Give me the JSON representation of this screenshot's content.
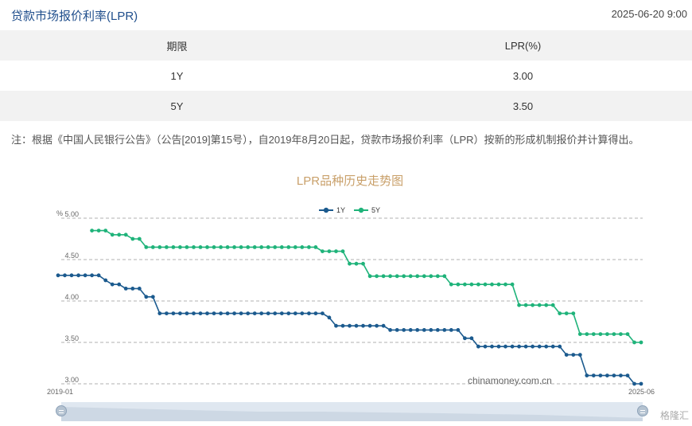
{
  "header": {
    "title": "贷款市场报价利率(LPR)",
    "timestamp": "2025-06-20 9:00"
  },
  "table": {
    "headers": [
      "期限",
      "LPR(%)"
    ],
    "rows": [
      {
        "term": "1Y",
        "rate": "3.00"
      },
      {
        "term": "5Y",
        "rate": "3.50"
      }
    ]
  },
  "note": "注：根据《中国人民银行公告》（公告[2019]第15号），自2019年8月20日起，贷款市场报价利率（LPR）按新的形成机制报价并计算得出。",
  "watermark": "chinamoney.com.cn",
  "logo_text": "格隆汇",
  "colors": {
    "series_1y": "#1b5a8e",
    "series_5y": "#1fb37a",
    "title": "#c9a06a",
    "grid": "#999999"
  },
  "chart_data": {
    "type": "line",
    "title": "LPR品种历史走势图",
    "ylabel": "%",
    "ylim": [
      3.0,
      5.0
    ],
    "yticks": [
      "5.00",
      "4.50",
      "4.00",
      "3.50",
      "3.00"
    ],
    "x_start_label": "2019-01",
    "x_end_label": "2025-06",
    "legend_position": "top-center",
    "grid": "horizontal-dashed",
    "series": [
      {
        "name": "1Y",
        "values": [
          4.31,
          4.31,
          4.31,
          4.31,
          4.31,
          4.31,
          4.31,
          4.25,
          4.2,
          4.2,
          4.15,
          4.15,
          4.15,
          4.05,
          4.05,
          3.85,
          3.85,
          3.85,
          3.85,
          3.85,
          3.85,
          3.85,
          3.85,
          3.85,
          3.85,
          3.85,
          3.85,
          3.85,
          3.85,
          3.85,
          3.85,
          3.85,
          3.85,
          3.85,
          3.85,
          3.85,
          3.85,
          3.85,
          3.85,
          3.85,
          3.8,
          3.7,
          3.7,
          3.7,
          3.7,
          3.7,
          3.7,
          3.7,
          3.7,
          3.65,
          3.65,
          3.65,
          3.65,
          3.65,
          3.65,
          3.65,
          3.65,
          3.65,
          3.65,
          3.65,
          3.55,
          3.55,
          3.45,
          3.45,
          3.45,
          3.45,
          3.45,
          3.45,
          3.45,
          3.45,
          3.45,
          3.45,
          3.45,
          3.45,
          3.45,
          3.35,
          3.35,
          3.35,
          3.1,
          3.1,
          3.1,
          3.1,
          3.1,
          3.1,
          3.1,
          3.0,
          3.0
        ]
      },
      {
        "name": "5Y",
        "values": [
          4.85,
          4.85,
          4.85,
          4.8,
          4.8,
          4.8,
          4.75,
          4.75,
          4.65,
          4.65,
          4.65,
          4.65,
          4.65,
          4.65,
          4.65,
          4.65,
          4.65,
          4.65,
          4.65,
          4.65,
          4.65,
          4.65,
          4.65,
          4.65,
          4.65,
          4.65,
          4.65,
          4.65,
          4.65,
          4.65,
          4.65,
          4.65,
          4.65,
          4.65,
          4.6,
          4.6,
          4.6,
          4.6,
          4.45,
          4.45,
          4.45,
          4.3,
          4.3,
          4.3,
          4.3,
          4.3,
          4.3,
          4.3,
          4.3,
          4.3,
          4.3,
          4.3,
          4.3,
          4.2,
          4.2,
          4.2,
          4.2,
          4.2,
          4.2,
          4.2,
          4.2,
          4.2,
          4.2,
          3.95,
          3.95,
          3.95,
          3.95,
          3.95,
          3.95,
          3.85,
          3.85,
          3.85,
          3.6,
          3.6,
          3.6,
          3.6,
          3.6,
          3.6,
          3.6,
          3.6,
          3.5,
          3.5
        ]
      }
    ]
  }
}
